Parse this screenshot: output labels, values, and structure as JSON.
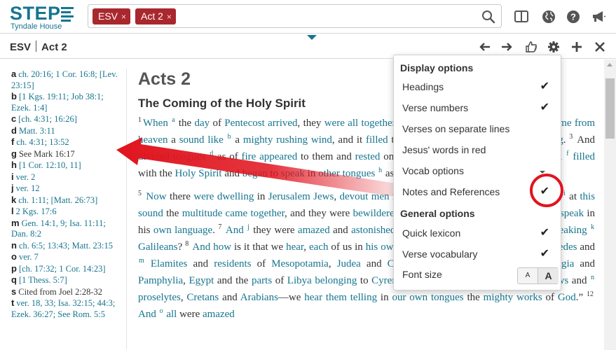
{
  "app": {
    "logo_text": "STEP",
    "logo_subtitle": "Tyndale House",
    "search": {
      "tags": [
        {
          "label": "ESV",
          "remove": "×"
        },
        {
          "label": "Act 2",
          "remove": "×"
        }
      ]
    },
    "top_icons": [
      "columns-icon",
      "globe-icon",
      "help-icon",
      "megaphone-icon"
    ]
  },
  "pane": {
    "version": "ESV",
    "reference": "Act 2",
    "toolbar_icons": [
      "arrow-left-icon",
      "arrow-right-icon",
      "thumbs-up-icon",
      "gear-icon",
      "plus-icon",
      "close-icon"
    ]
  },
  "notes": [
    {
      "letter": "a",
      "text": "ch. 20:16; 1 Cor. 16:8; [Lev. 23:15]"
    },
    {
      "letter": "b",
      "text": "[1 Kgs. 19:11; Job 38:1; Ezek. 1:4]"
    },
    {
      "letter": "c",
      "text": "[ch. 4:31; 16:26]"
    },
    {
      "letter": "d",
      "text": "Matt. 3:11"
    },
    {
      "letter": "f",
      "text": "ch. 4:31; 13:52"
    },
    {
      "letter": "g",
      "text": "See Mark 16:17"
    },
    {
      "letter": "h",
      "text": "[1 Cor. 12:10, 11]"
    },
    {
      "letter": "i",
      "text": "ver. 2"
    },
    {
      "letter": "j",
      "text": "ver. 12"
    },
    {
      "letter": "k",
      "text": "ch. 1:11; [Matt. 26:73]"
    },
    {
      "letter": "l",
      "text": "2 Kgs. 17:6"
    },
    {
      "letter": "m",
      "text": "Gen. 14:1, 9; Isa. 11:11; Dan. 8:2"
    },
    {
      "letter": "n",
      "text": "ch. 6:5; 13:43; Matt. 23:15"
    },
    {
      "letter": "o",
      "text": "ver. 7"
    },
    {
      "letter": "p",
      "text": "[ch. 17:32; 1 Cor. 14:23]"
    },
    {
      "letter": "q",
      "text": "[1 Thess. 5:7]"
    },
    {
      "letter": "s",
      "text": "Cited from Joel 2:28-32"
    },
    {
      "letter": "t",
      "text": "ver. 18, 33; Isa. 32:15; 44:3; Ezek. 36:27; See Rom. 5:5"
    }
  ],
  "passage": {
    "chapter_title": "Acts 2",
    "section_title": "The Coming of the Holy Spirit"
  },
  "options": {
    "display_heading": "Display options",
    "display_items": [
      {
        "label": "Headings",
        "checked": "✔"
      },
      {
        "label": "Verse numbers",
        "checked": "✔"
      },
      {
        "label": "Verses on separate lines",
        "checked": ""
      },
      {
        "label": "Jesus' words in red",
        "checked": ""
      },
      {
        "label": "Vocab options",
        "checked": ""
      },
      {
        "label": "Notes and References",
        "checked": "✔"
      }
    ],
    "general_heading": "General options",
    "general_items": [
      {
        "label": "Quick lexicon",
        "checked": "✔"
      },
      {
        "label": "Verse vocabulary",
        "checked": "✔"
      },
      {
        "label": "Font size",
        "checked": ""
      }
    ],
    "font_small": "A",
    "font_large": "A"
  },
  "colors": {
    "brand": "#17758f",
    "tag_bg": "#a9282e",
    "annotation": "#e0141e"
  }
}
